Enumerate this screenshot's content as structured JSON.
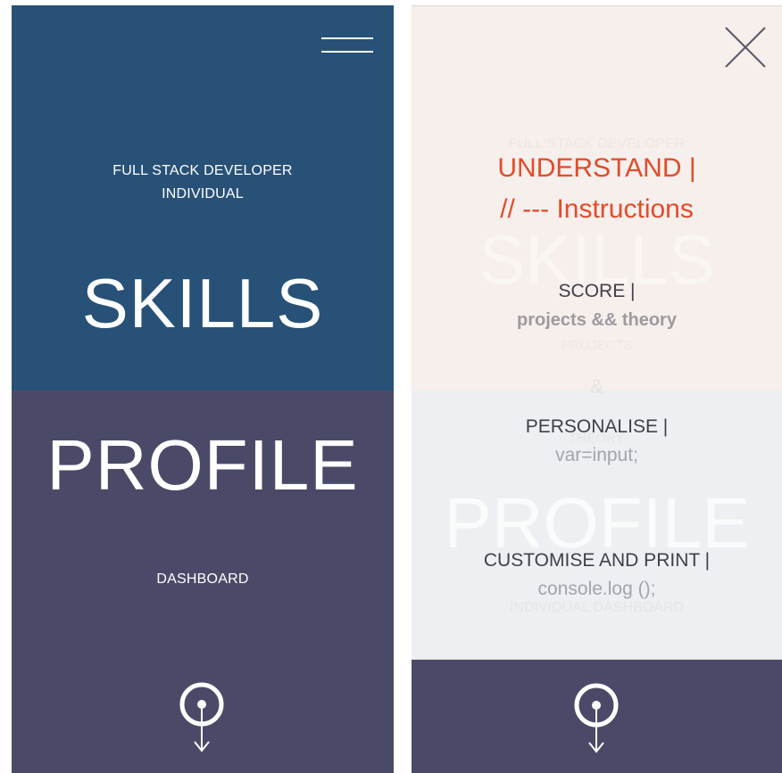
{
  "left": {
    "subtitle_line1": "FULL STACK DEVELOPER",
    "subtitle_line2": "INDIVIDUAL",
    "skills": "SKILLS",
    "profile": "PROFILE",
    "dashboard": "DASHBOARD",
    "menu_icon": "hamburger-icon",
    "scroll_icon": "scroll-down-icon"
  },
  "right": {
    "close_icon": "close-icon",
    "ghost": {
      "subtitle": "FULL STACK DEVELOPER",
      "skills": "SKILLS",
      "projects": "PROJECTS",
      "amp": "&",
      "theory": "THEORY",
      "profile": "PROFILE",
      "dashboard": "INDIVIDUAL DASHBOARD"
    },
    "menu": {
      "heading": "UNDERSTAND |",
      "heading_sub": "// --- Instructions",
      "items": [
        {
          "label": "SCORE |",
          "sub": "projects && theory"
        },
        {
          "label": "PERSONALISE |",
          "sub": "var=input;"
        },
        {
          "label": "CUSTOMISE AND PRINT |",
          "sub": "console.log ();"
        }
      ]
    },
    "scroll_icon": "scroll-down-icon"
  },
  "colors": {
    "blue": "#285177",
    "slate": "#4a4a68",
    "accent": "#e34b2a",
    "cream": "#f6efec",
    "light_grey": "#eeeff2"
  }
}
